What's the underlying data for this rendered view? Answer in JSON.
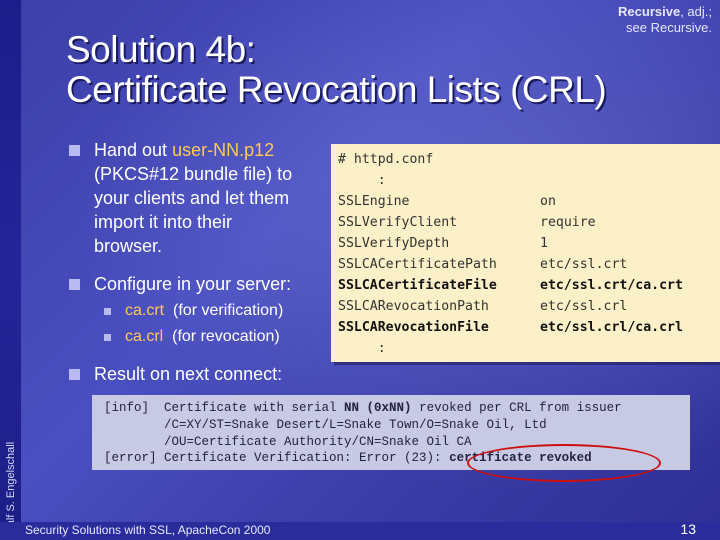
{
  "quote": {
    "word": "Recursive",
    "rest": ", adj.;",
    "line2": "see Recursive."
  },
  "title": {
    "line1": "Solution 4b:",
    "line2": "Certificate Revocation Lists (CRL)"
  },
  "bullets": {
    "b1_prefix": "Hand out ",
    "b1_file": "user-NN.p12",
    "b1_lines": [
      "(PKCS#12 bundle file) to",
      "your clients and let them",
      "import it into their",
      "browser."
    ],
    "b2": "Configure in your server:",
    "sub1_file": "ca.crt",
    "sub1_note": "(for verification)",
    "sub2_file": "ca.crl",
    "sub2_note": "(for revocation)",
    "b3": "Result on next connect:"
  },
  "config": {
    "rows": [
      {
        "k": "# httpd.conf",
        "v": ""
      },
      {
        "k": "     :",
        "v": ""
      },
      {
        "k": "SSLEngine",
        "v": "on"
      },
      {
        "k": "SSLVerifyClient",
        "v": "require"
      },
      {
        "k": "SSLVerifyDepth",
        "v": "1"
      },
      {
        "k": "SSLCACertificatePath",
        "v": "etc/ssl.crt"
      },
      {
        "k": "SSLCACertificateFile",
        "v": "etc/ssl.crt/ca.crt"
      },
      {
        "k": "SSLCARevocationPath",
        "v": "etc/ssl.crl"
      },
      {
        "k": "SSLCARevocationFile",
        "v": "etc/ssl.crl/ca.crl"
      },
      {
        "k": "     :",
        "v": ""
      }
    ]
  },
  "log": {
    "l1a": "[info]  Certificate with serial ",
    "l1b": "NN (0xNN)",
    "l1c": " revoked per CRL from issuer",
    "l2": "        /C=XY/ST=Snake Desert/L=Snake Town/O=Snake Oil, Ltd",
    "l3": "        /OU=Certificate Authority/CN=Snake Oil CA",
    "l4a": "[error] Certificate Verification: Error (23): ",
    "l4b": "certificate revoked"
  },
  "sidebar": {
    "author": "Ralf S. Engelschall"
  },
  "footer": {
    "text": "Security Solutions with SSL, ApacheCon 2000",
    "page": "13"
  }
}
